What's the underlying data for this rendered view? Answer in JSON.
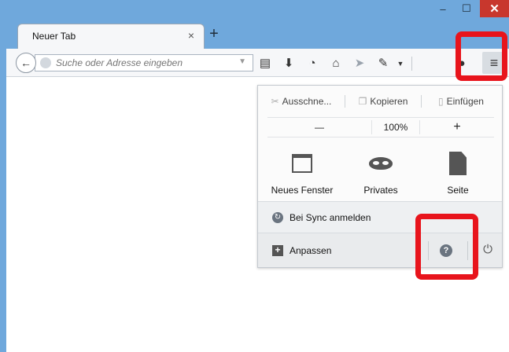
{
  "window": {
    "minimize_glyph": "–",
    "maximize_glyph": "☐",
    "close_glyph": "✕"
  },
  "tab": {
    "title": "Neuer Tab",
    "close_glyph": "×",
    "new_tab_glyph": "+"
  },
  "navbar": {
    "back_glyph": "←",
    "url_placeholder": "Suche oder Adresse eingeben",
    "menu_glyph": "≡",
    "icons": [
      "bookmark-list-icon",
      "download-icon",
      "history-icon",
      "home-icon",
      "send-icon",
      "tools-icon",
      "more-icon",
      "chat-icon",
      "menu-icon"
    ]
  },
  "menu_panel": {
    "edit": {
      "cut": "Ausschne...",
      "copy": "Kopieren",
      "paste": "Einfügen"
    },
    "zoom": {
      "minus": "—",
      "value": "100%",
      "plus": "+"
    },
    "buttons": {
      "new_window": "Neues Fenster",
      "private": "Privates",
      "page": "Seite"
    },
    "sync": "Bei Sync anmelden",
    "customize": "Anpassen",
    "help_glyph": "?",
    "power_glyph": "⏻"
  },
  "colors": {
    "titlebar": "#6fa8dc",
    "highlight": "#e8141c",
    "close_button": "#c8372d"
  }
}
